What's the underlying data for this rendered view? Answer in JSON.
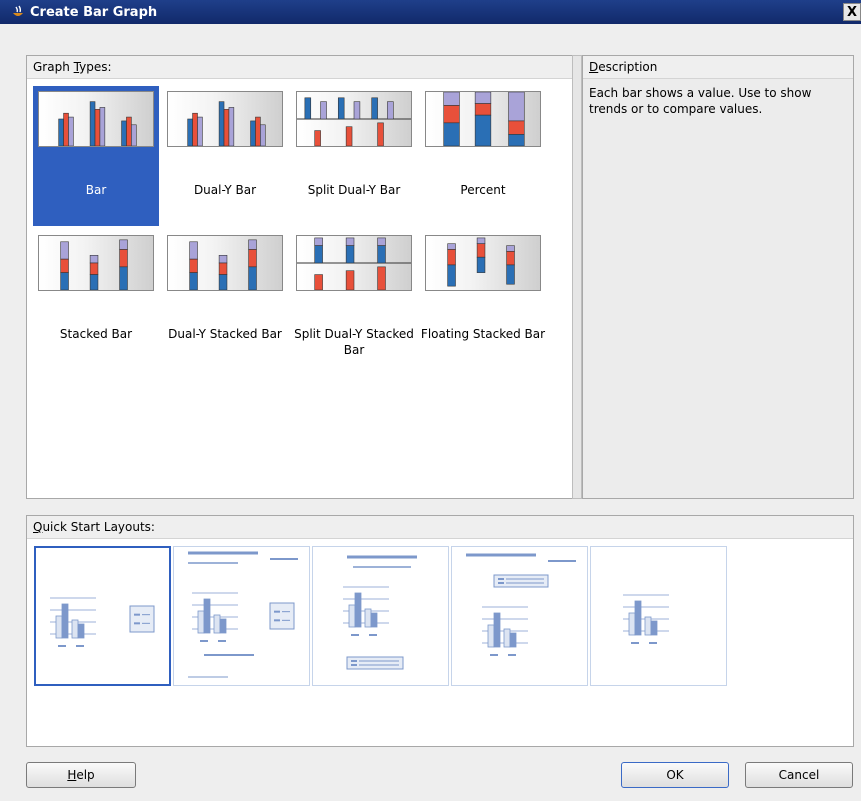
{
  "window": {
    "title": "Create Bar Graph",
    "close_glyph": "X"
  },
  "graph_types": {
    "header_label": "Graph Types:",
    "header_underline": "T",
    "items": [
      {
        "label": "Bar",
        "icon": "bar-chart-icon",
        "selected": true
      },
      {
        "label": "Dual-Y Bar",
        "icon": "dual-y-bar-chart-icon",
        "selected": false
      },
      {
        "label": "Split Dual-Y Bar",
        "icon": "split-dual-y-bar-chart-icon",
        "selected": false
      },
      {
        "label": "Percent",
        "icon": "percent-bar-chart-icon",
        "selected": false
      },
      {
        "label": "Stacked Bar",
        "icon": "stacked-bar-chart-icon",
        "selected": false
      },
      {
        "label": "Dual-Y Stacked Bar",
        "icon": "dual-y-stacked-bar-chart-icon",
        "selected": false
      },
      {
        "label": "Split Dual-Y Stacked Bar",
        "icon": "split-dual-y-stacked-bar-chart-icon",
        "selected": false
      },
      {
        "label": "Floating Stacked Bar",
        "icon": "floating-stacked-bar-chart-icon",
        "selected": false
      }
    ]
  },
  "description": {
    "header_label": "Description",
    "text": "Each bar shows a value. Use to show trends or to compare values."
  },
  "quick_start": {
    "header_label": "Quick Start Layouts:",
    "layouts": [
      {
        "icon": "layout-legend-right-icon",
        "selected": true
      },
      {
        "icon": "layout-full-titles-legend-right-icon",
        "selected": false
      },
      {
        "icon": "layout-title-legend-bottom-icon",
        "selected": false
      },
      {
        "icon": "layout-title-legend-top-icon",
        "selected": false
      },
      {
        "icon": "layout-plain-icon",
        "selected": false
      }
    ]
  },
  "buttons": {
    "help": "Help",
    "ok": "OK",
    "cancel": "Cancel"
  },
  "colors": {
    "accent": "#2f5fbf",
    "bar_blue": "#2a6fb5",
    "bar_red": "#e8503a",
    "bar_purple": "#a9a3d8",
    "layout_blue": "#7d98cb"
  }
}
